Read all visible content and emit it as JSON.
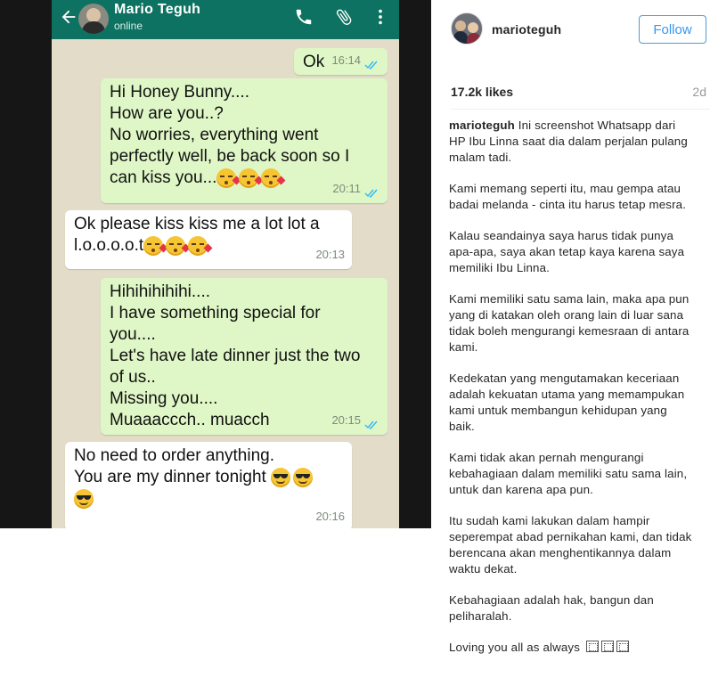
{
  "whatsapp": {
    "contact_name": "Mario Teguh",
    "contact_status": "online",
    "icons": [
      "back-arrow-icon",
      "phone-icon",
      "attach-icon",
      "more-icon"
    ],
    "colors": {
      "header": "#0d7261",
      "outgoing": "#dff7c6",
      "incoming": "#ffffff",
      "read_tick": "#34b7f1"
    },
    "messages": [
      {
        "direction": "out",
        "text": "Ok",
        "time": "16:14",
        "emojis": []
      },
      {
        "direction": "out",
        "text": "Hi Honey Bunny....\nHow are you..?\nNo worries, everything went\nperfectly well, be back soon so I\ncan kiss you...",
        "time": "20:11",
        "emojis": [
          "kiss-face",
          "kiss-face",
          "kiss-face"
        ]
      },
      {
        "direction": "in",
        "text": "Ok please kiss kiss me a lot lot a\nl.o.o.o.o.t",
        "time": "20:13",
        "emojis": [
          "kiss-face",
          "kiss-face",
          "kiss-face"
        ]
      },
      {
        "direction": "out",
        "text": "Hihihihihihi....\nI have something special for\nyou....\nLet's have late dinner just the two\nof us..\nMissing you....\nMuaaaccch.. muacch",
        "time": "20:15",
        "emojis": []
      },
      {
        "direction": "in",
        "text": "No need to order anything.\nYou are my dinner tonight",
        "time": "20:16",
        "emojis": [
          "cool-face",
          "cool-face",
          "cool-face"
        ]
      }
    ]
  },
  "instagram": {
    "username": "marioteguh",
    "follow_label": "Follow",
    "likes": "17.2k likes",
    "time_ago": "2d",
    "caption_user": "marioteguh",
    "caption_paragraphs": [
      "Ini screenshot Whatsapp dari HP Ibu Linna saat dia dalam perjalan pulang malam tadi.",
      "Kami memang seperti itu, mau gempa atau badai melanda - cinta itu harus tetap mesra.",
      "Kalau seandainya saya harus tidak punya apa-apa, saya akan tetap kaya karena saya memiliki Ibu Linna.",
      "Kami memiliki satu sama lain, maka apa pun yang di katakan oleh orang lain di luar sana tidak boleh mengurangi kemesraan di antara kami.",
      "Kedekatan yang mengutamakan keceriaan adalah kekuatan utama yang memampukan kami untuk membangun kehidupan yang baik.",
      "Kami tidak akan pernah mengurangi kebahagiaan dalam memiliki satu sama lain, untuk dan karena apa pun.",
      "Itu sudah kami lakukan dalam hampir seperempat abad pernikahan kami, dan tidak berencana akan menghentikannya dalam waktu dekat.",
      "Kebahagiaan adalah hak, bangun dan peliharalah.",
      "Loving you all as always"
    ]
  }
}
